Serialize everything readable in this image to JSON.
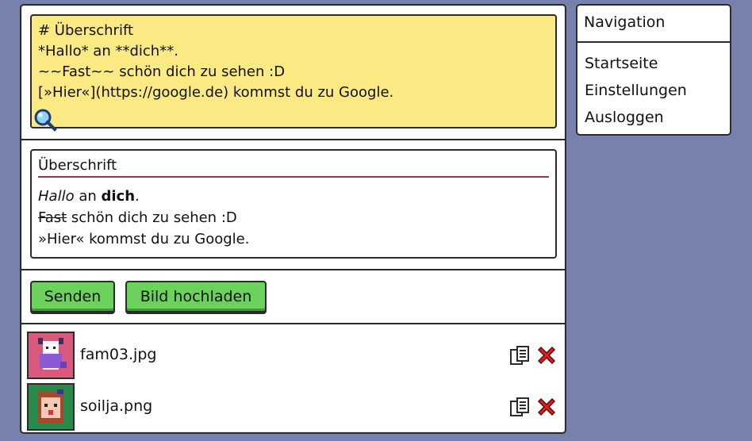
{
  "editor": {
    "lines": [
      "# Überschrift",
      "*Hallo* an **dich**.",
      "~~Fast~~ schön dich zu sehen :D",
      "[»Hier«](https://google.de) kommst du zu Google."
    ]
  },
  "preview": {
    "heading": "Überschrift",
    "line1": {
      "italic": "Hallo",
      "middle": " an ",
      "bold": "dich",
      "end": "."
    },
    "line2": {
      "strike": "Fast",
      "rest": " schön dich zu sehen :D"
    },
    "line3": {
      "link": "»Hier«",
      "rest": " kommst du zu Google."
    }
  },
  "actions": {
    "send_label": "Senden",
    "upload_label": "Bild hochladen"
  },
  "files": [
    {
      "name": "fam03.jpg",
      "thumb_bg": "#d75a7d"
    },
    {
      "name": "soilja.png",
      "thumb_bg": "#2b8a4b"
    }
  ],
  "nav": {
    "title": "Navigation",
    "items": [
      {
        "label": "Startseite"
      },
      {
        "label": "Einstellungen"
      },
      {
        "label": "Ausloggen"
      }
    ]
  },
  "colors": {
    "background": "#7781ad",
    "editor_bg": "#fbe984",
    "button_green": "#6bd35c",
    "heading_rule": "#8b3b4c",
    "delete_red": "#e02020"
  }
}
